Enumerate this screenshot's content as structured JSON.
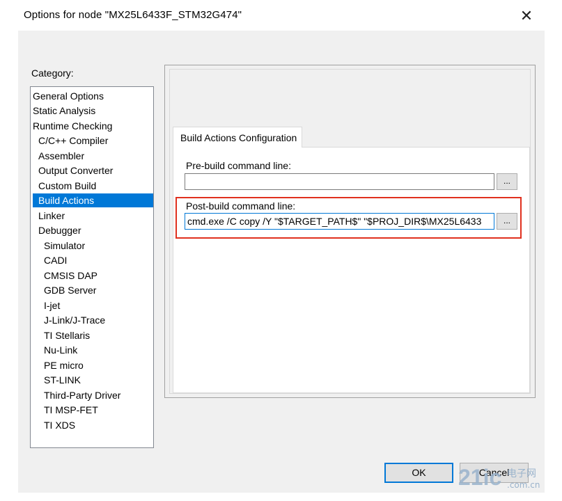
{
  "window": {
    "title": "Options for node \"MX25L6433F_STM32G474\"",
    "close_glyph": "✕"
  },
  "category": {
    "label": "Category:",
    "items": [
      {
        "label": "General Options"
      },
      {
        "label": "Static Analysis"
      },
      {
        "label": "Runtime Checking"
      },
      {
        "label": "C/C++ Compiler"
      },
      {
        "label": "Assembler"
      },
      {
        "label": "Output Converter"
      },
      {
        "label": "Custom Build"
      },
      {
        "label": "Build Actions",
        "selected": true
      },
      {
        "label": "Linker"
      },
      {
        "label": "Debugger"
      },
      {
        "label": "Simulator"
      },
      {
        "label": "CADI"
      },
      {
        "label": "CMSIS DAP"
      },
      {
        "label": "GDB Server"
      },
      {
        "label": "I-jet"
      },
      {
        "label": "J-Link/J-Trace"
      },
      {
        "label": "TI Stellaris"
      },
      {
        "label": "Nu-Link"
      },
      {
        "label": "PE micro"
      },
      {
        "label": "ST-LINK"
      },
      {
        "label": "Third-Party Driver"
      },
      {
        "label": "TI MSP-FET"
      },
      {
        "label": "TI XDS"
      }
    ]
  },
  "tab": {
    "label": "Build Actions Configuration"
  },
  "prebuild": {
    "label": "Pre-build command line:",
    "value": "",
    "browse_label": "..."
  },
  "postbuild": {
    "label": "Post-build command line:",
    "value": "cmd.exe /C copy /Y \"$TARGET_PATH$\" \"$PROJ_DIR$\\MX25L6433",
    "browse_label": "..."
  },
  "buttons": {
    "ok": "OK",
    "cancel": "Cancel"
  },
  "watermark": {
    "big": "21ic",
    "cn": "电子网",
    "url": ".com.cn"
  },
  "colors": {
    "selection": "#0078d7",
    "highlight_box": "#e0301e",
    "dialog_bg": "#f0f0f0"
  }
}
